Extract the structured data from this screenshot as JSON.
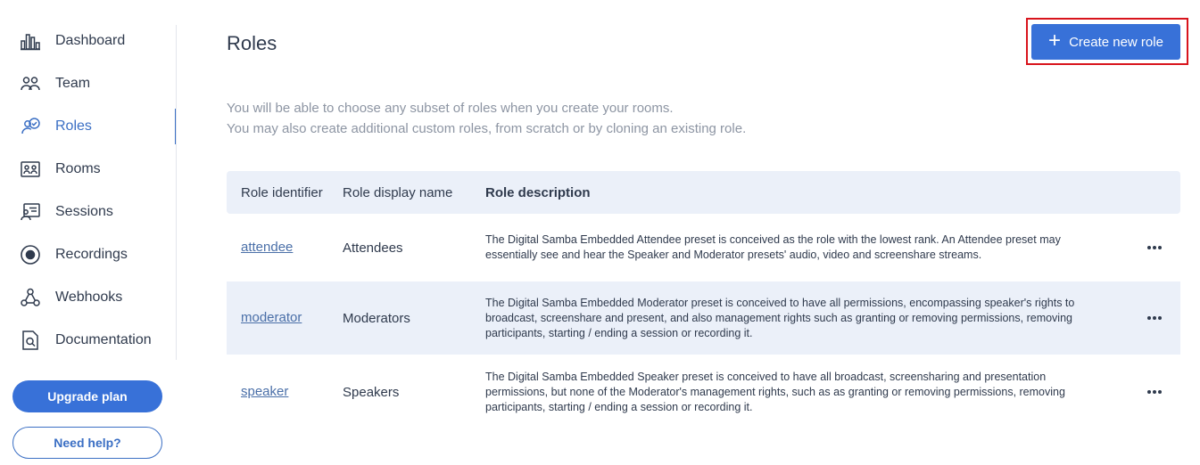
{
  "sidebar": {
    "items": [
      {
        "label": "Dashboard",
        "icon": "bar-chart-icon"
      },
      {
        "label": "Team",
        "icon": "team-icon"
      },
      {
        "label": "Roles",
        "icon": "roles-icon",
        "active": true
      },
      {
        "label": "Rooms",
        "icon": "rooms-icon"
      },
      {
        "label": "Sessions",
        "icon": "sessions-icon"
      },
      {
        "label": "Recordings",
        "icon": "record-icon"
      },
      {
        "label": "Webhooks",
        "icon": "webhook-icon"
      },
      {
        "label": "Documentation",
        "icon": "documentation-icon"
      }
    ],
    "upgrade_label": "Upgrade plan",
    "help_label": "Need help?"
  },
  "main": {
    "title": "Roles",
    "create_label": "Create new role",
    "intro_line1": "You will be able to choose any subset of roles when you create your rooms.",
    "intro_line2": "You may also create additional custom roles, from scratch or by cloning an existing role."
  },
  "table": {
    "headers": {
      "id": "Role identifier",
      "name": "Role display name",
      "desc": "Role description"
    },
    "rows": [
      {
        "id": "attendee",
        "name": "Attendees",
        "desc": "The Digital Samba Embedded Attendee preset is conceived as the role with the lowest rank. An Attendee preset may essentially see and hear the Speaker and Moderator presets' audio, video and screenshare streams."
      },
      {
        "id": "moderator",
        "name": "Moderators",
        "desc": "The Digital Samba Embedded Moderator preset is conceived to have all permissions, encompassing speaker's rights to broadcast, screenshare and present, and also management rights such as granting or removing permissions, removing participants, starting / ending a session or recording it."
      },
      {
        "id": "speaker",
        "name": "Speakers",
        "desc": "The Digital Samba Embedded Speaker preset is conceived to have all broadcast, screensharing and presentation permissions, but none of the Moderator's management rights, such as as granting or removing permissions, removing participants, starting / ending a session or recording it."
      }
    ]
  },
  "colors": {
    "accent": "#3871d8",
    "highlight": "#d8141c",
    "row_bg": "#ebf0f9"
  }
}
